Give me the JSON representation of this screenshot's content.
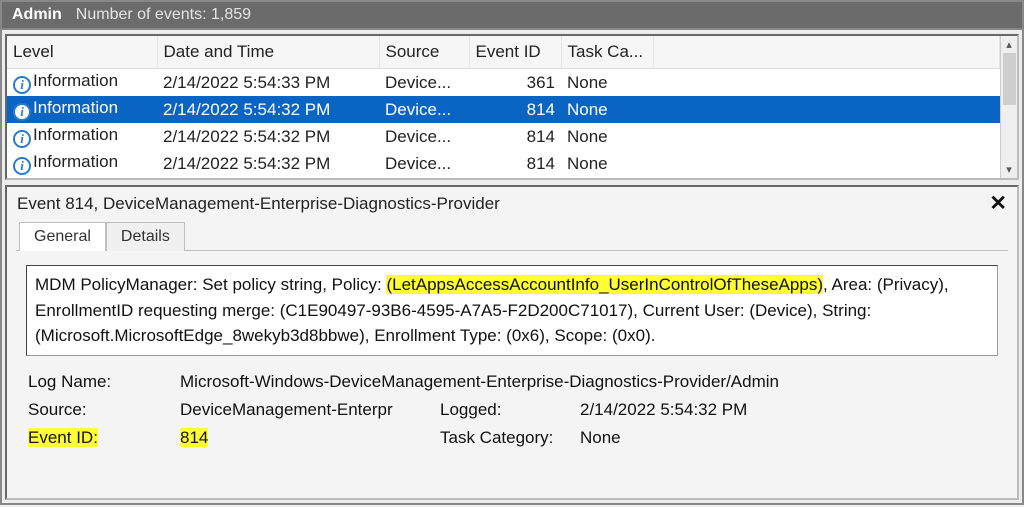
{
  "titlebar": {
    "admin": "Admin",
    "count_label": "Number of events:",
    "count_value": "1,859"
  },
  "columns": {
    "level": "Level",
    "date": "Date and Time",
    "source": "Source",
    "event_id": "Event ID",
    "task": "Task Ca..."
  },
  "rows": [
    {
      "level": "Information",
      "date": "2/14/2022 5:54:33 PM",
      "source": "Device...",
      "event_id": "361",
      "task": "None",
      "selected": false
    },
    {
      "level": "Information",
      "date": "2/14/2022 5:54:32 PM",
      "source": "Device...",
      "event_id": "814",
      "task": "None",
      "selected": true
    },
    {
      "level": "Information",
      "date": "2/14/2022 5:54:32 PM",
      "source": "Device...",
      "event_id": "814",
      "task": "None",
      "selected": false
    },
    {
      "level": "Information",
      "date": "2/14/2022 5:54:32 PM",
      "source": "Device...",
      "event_id": "814",
      "task": "None",
      "selected": false
    }
  ],
  "detail": {
    "header": "Event 814, DeviceManagement-Enterprise-Diagnostics-Provider",
    "tabs": {
      "general": "General",
      "details": "Details"
    },
    "message": {
      "part1": "MDM PolicyManager: Set policy string, Policy: ",
      "hl1": "(LetAppsAccessAccountInfo_UserInControlOfTheseApps)",
      "part2": ", Area: (Privacy), EnrollmentID requesting merge: (C1E90497-93B6-4595-A7A5-F2D200C71017), Current User: (Device), String: (Microsoft.MicrosoftEdge_8wekyb3d8bbwe), Enrollment Type: (0x6), Scope: (0x0)."
    },
    "props": {
      "log_name_label": "Log Name:",
      "log_name_value": "Microsoft-Windows-DeviceManagement-Enterprise-Diagnostics-Provider/Admin",
      "source_label": "Source:",
      "source_value": "DeviceManagement-Enterpr",
      "logged_label": "Logged:",
      "logged_value": "2/14/2022 5:54:32 PM",
      "event_id_label": "Event ID:",
      "event_id_value": "814",
      "task_label": "Task Category:",
      "task_value": "None"
    }
  }
}
